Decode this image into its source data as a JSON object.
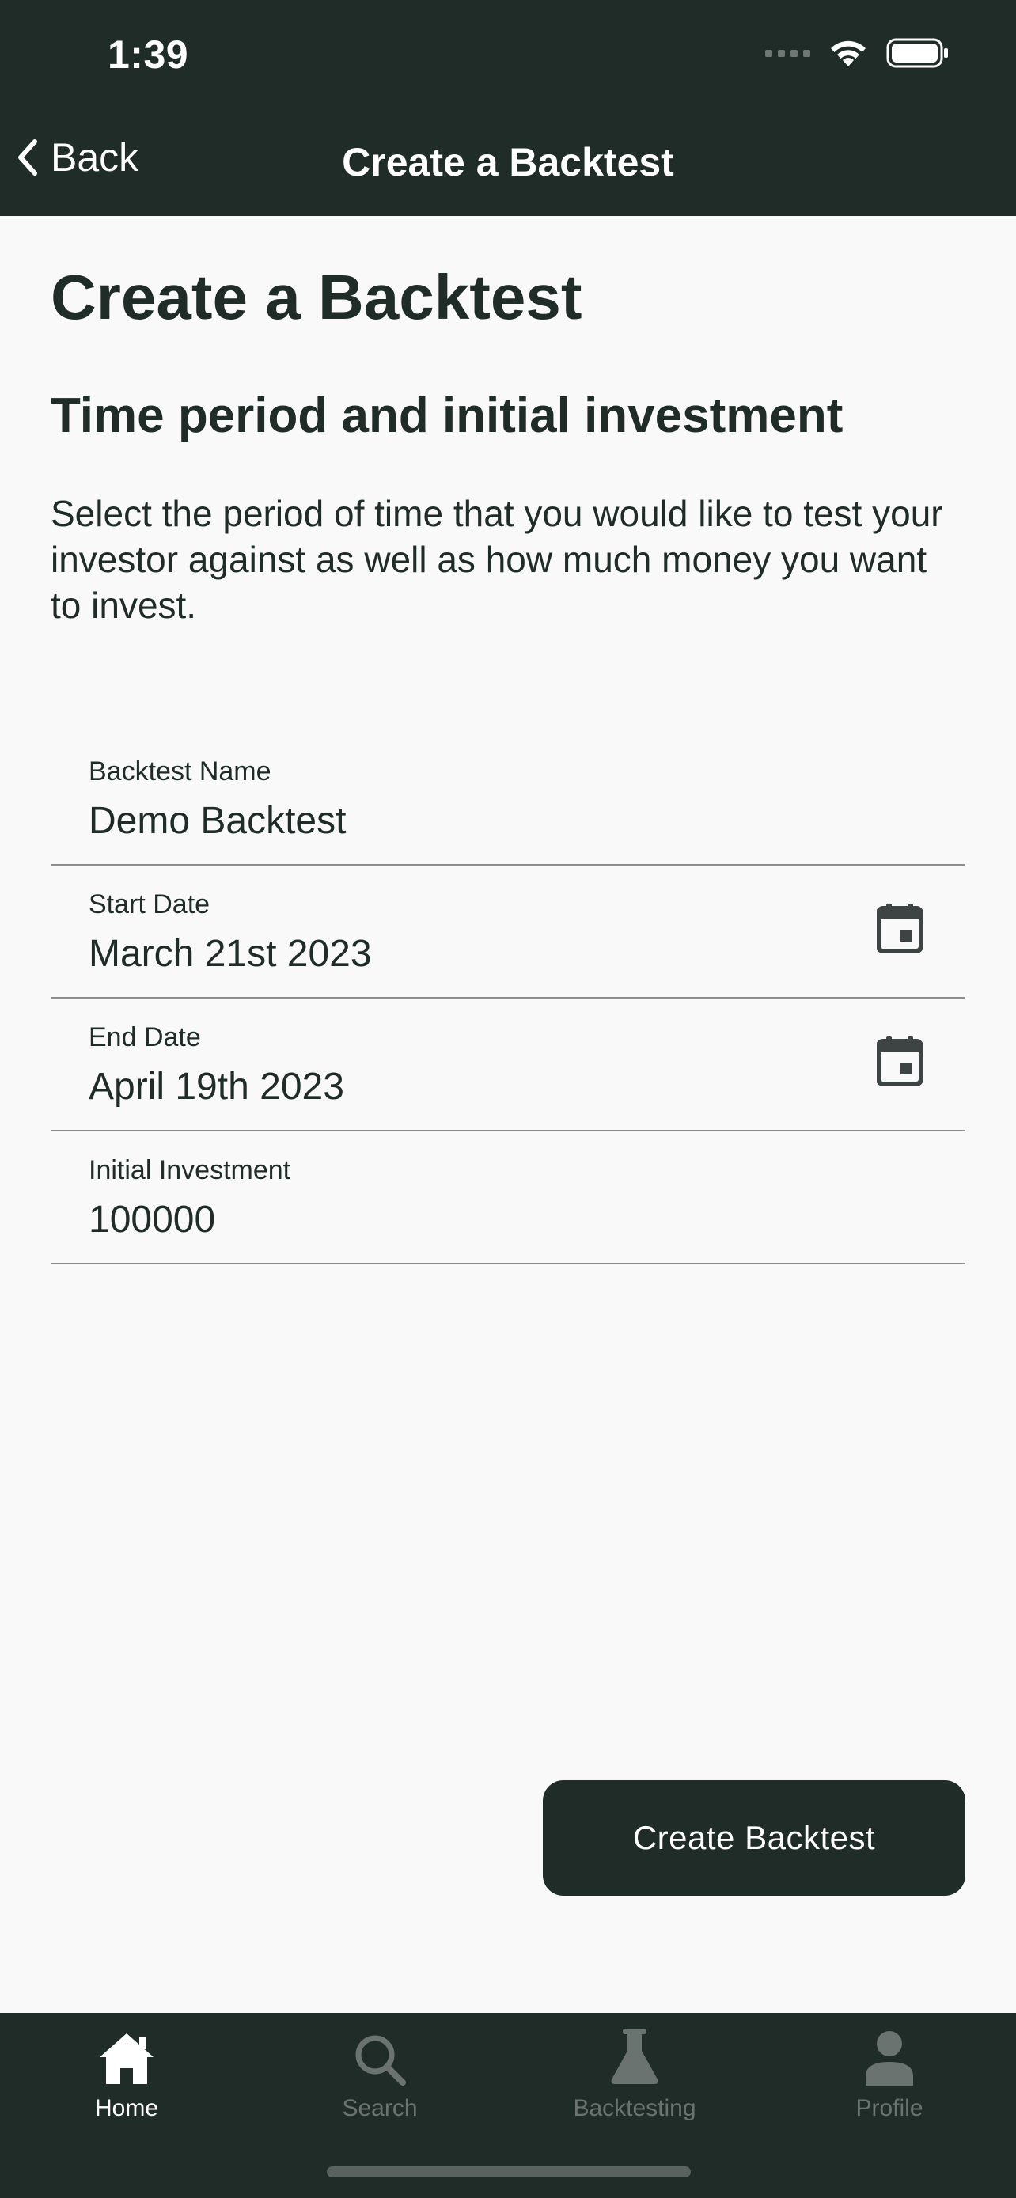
{
  "status_bar": {
    "time": "1:39"
  },
  "nav": {
    "back_label": "Back",
    "title": "Create a Backtest"
  },
  "page": {
    "title": "Create a Backtest",
    "section_title": "Time period and initial investment",
    "description": "Select the period of time that you would like to test your investor against as well as how much money you want to invest."
  },
  "form": {
    "name": {
      "label": "Backtest Name",
      "value": "Demo Backtest"
    },
    "start_date": {
      "label": "Start Date",
      "value": "March 21st 2023",
      "icon": "calendar-icon"
    },
    "end_date": {
      "label": "End Date",
      "value": "April 19th 2023",
      "icon": "calendar-icon"
    },
    "initial_investment": {
      "label": "Initial Investment",
      "value": "100000"
    }
  },
  "actions": {
    "create_label": "Create Backtest"
  },
  "tabs": [
    {
      "label": "Home",
      "icon": "home-icon",
      "active": true
    },
    {
      "label": "Search",
      "icon": "search-icon",
      "active": false
    },
    {
      "label": "Backtesting",
      "icon": "flask-icon",
      "active": false
    },
    {
      "label": "Profile",
      "icon": "person-icon",
      "active": false
    }
  ],
  "colors": {
    "primary": "#202c28",
    "background": "#f9f9f9",
    "inactive_tab": "#6b7370"
  }
}
